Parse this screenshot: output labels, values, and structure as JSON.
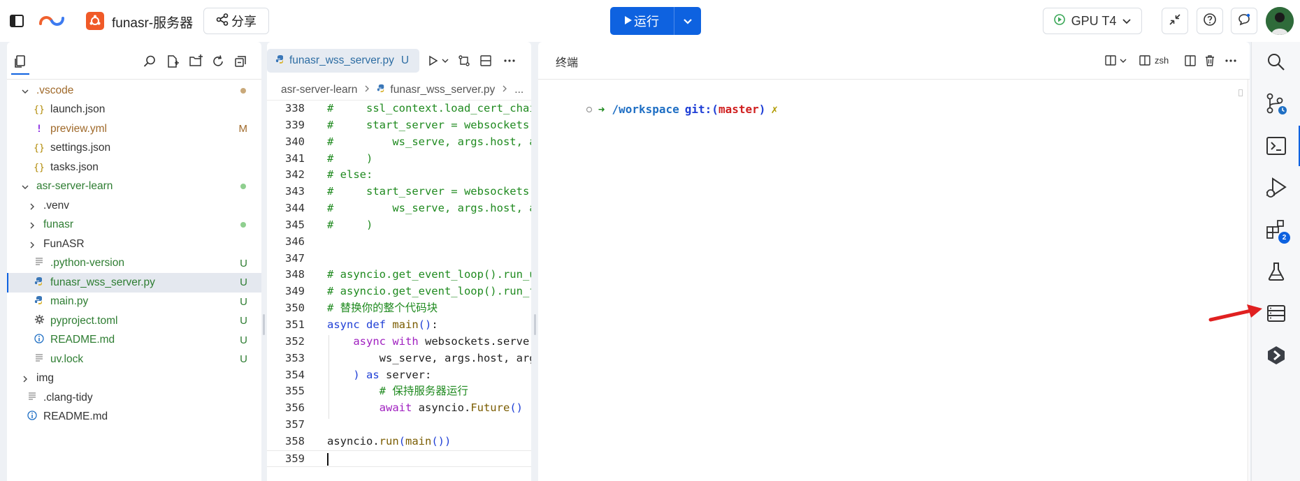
{
  "topbar": {
    "project_name": "funasr-服务器",
    "share_label": "分享",
    "run_label": "运行",
    "gpu_label": "GPU T4"
  },
  "explorer": {
    "tree": [
      {
        "name": ".vscode",
        "type": "folder",
        "open": true,
        "depth": 0,
        "status": "dot",
        "color": "mod"
      },
      {
        "name": "launch.json",
        "type": "json",
        "depth": 1,
        "color": "plain"
      },
      {
        "name": "preview.yml",
        "type": "yml",
        "depth": 1,
        "status": "M",
        "color": "mod"
      },
      {
        "name": "settings.json",
        "type": "json",
        "depth": 1,
        "color": "plain"
      },
      {
        "name": "tasks.json",
        "type": "json",
        "depth": 1,
        "color": "plain"
      },
      {
        "name": "asr-server-learn",
        "type": "folder",
        "open": true,
        "depth": 0,
        "status": "dot",
        "color": "untracked"
      },
      {
        "name": ".venv",
        "type": "folder",
        "open": false,
        "depth": 1,
        "color": "plain"
      },
      {
        "name": "funasr",
        "type": "folder",
        "open": false,
        "depth": 1,
        "status": "dot",
        "color": "untracked"
      },
      {
        "name": "FunASR",
        "type": "folder",
        "open": false,
        "depth": 1,
        "color": "plain"
      },
      {
        "name": ".python-version",
        "type": "text",
        "depth": 1,
        "status": "U",
        "color": "untracked"
      },
      {
        "name": "funasr_wss_server.py",
        "type": "python",
        "depth": 1,
        "status": "U",
        "color": "untracked",
        "selected": true
      },
      {
        "name": "main.py",
        "type": "python",
        "depth": 1,
        "status": "U",
        "color": "untracked"
      },
      {
        "name": "pyproject.toml",
        "type": "toml",
        "depth": 1,
        "status": "U",
        "color": "untracked"
      },
      {
        "name": "README.md",
        "type": "info",
        "depth": 1,
        "status": "U",
        "color": "untracked"
      },
      {
        "name": "uv.lock",
        "type": "text",
        "depth": 1,
        "status": "U",
        "color": "untracked"
      },
      {
        "name": "img",
        "type": "folder",
        "open": false,
        "depth": 0,
        "color": "plain"
      },
      {
        "name": ".clang-tidy",
        "type": "text",
        "depth": 0,
        "color": "plain"
      },
      {
        "name": "README.md",
        "type": "info",
        "depth": 0,
        "color": "plain"
      }
    ]
  },
  "editor": {
    "tab": {
      "name": "funasr_wss_server.py",
      "status": "U"
    },
    "breadcrumb": [
      "asr-server-learn",
      "funasr_wss_server.py",
      "..."
    ],
    "lines": [
      {
        "n": "338",
        "code": [
          [
            "cm",
            "#     ssl_context.load_cert_chain("
          ]
        ]
      },
      {
        "n": "339",
        "code": [
          [
            "cm",
            "#     start_server = websockets.serve("
          ]
        ]
      },
      {
        "n": "340",
        "code": [
          [
            "cm",
            "#         ws_serve, args.host, args.port"
          ]
        ]
      },
      {
        "n": "341",
        "code": [
          [
            "cm",
            "#     )"
          ]
        ]
      },
      {
        "n": "342",
        "code": [
          [
            "cm",
            "# else:"
          ]
        ]
      },
      {
        "n": "343",
        "code": [
          [
            "cm",
            "#     start_server = websockets.serve("
          ]
        ]
      },
      {
        "n": "344",
        "code": [
          [
            "cm",
            "#         ws_serve, args.host, args.port"
          ]
        ]
      },
      {
        "n": "345",
        "code": [
          [
            "cm",
            "#     )"
          ]
        ]
      },
      {
        "n": "346",
        "code": []
      },
      {
        "n": "347",
        "code": []
      },
      {
        "n": "348",
        "code": [
          [
            "cm",
            "# asyncio.get_event_loop().run_until_complete("
          ]
        ]
      },
      {
        "n": "349",
        "code": [
          [
            "cm",
            "# asyncio.get_event_loop().run_forever()"
          ]
        ]
      },
      {
        "n": "350",
        "code": [
          [
            "cm",
            "# 替换你的整个代码块"
          ]
        ]
      },
      {
        "n": "351",
        "code": [
          [
            "kb",
            "async "
          ],
          [
            "kb",
            "def "
          ],
          [
            "fn",
            "main"
          ],
          [
            "pn",
            "()"
          ],
          [
            "tx",
            ":"
          ]
        ]
      },
      {
        "n": "352",
        "code": [
          [
            "tx",
            "    "
          ],
          [
            "kw",
            "async "
          ],
          [
            "kw",
            "with "
          ],
          [
            "tx",
            "websockets.serve("
          ]
        ]
      },
      {
        "n": "353",
        "code": [
          [
            "tx",
            "        ws_serve, args.host, args.port"
          ]
        ]
      },
      {
        "n": "354",
        "code": [
          [
            "tx",
            "    "
          ],
          [
            "pn",
            ") "
          ],
          [
            "kb",
            "as "
          ],
          [
            "tx",
            "server:"
          ]
        ]
      },
      {
        "n": "355",
        "code": [
          [
            "tx",
            "        "
          ],
          [
            "cm",
            "# 保持服务器运行"
          ]
        ]
      },
      {
        "n": "356",
        "code": [
          [
            "tx",
            "        "
          ],
          [
            "kw",
            "await "
          ],
          [
            "tx",
            "asyncio."
          ],
          [
            "fn",
            "Future"
          ],
          [
            "pn",
            "()"
          ]
        ]
      },
      {
        "n": "357",
        "code": []
      },
      {
        "n": "358",
        "code": [
          [
            "tx",
            "asyncio."
          ],
          [
            "fn",
            "run"
          ],
          [
            "pn",
            "("
          ],
          [
            "fn",
            "main"
          ],
          [
            "pn",
            "())"
          ]
        ]
      },
      {
        "n": "359",
        "code": []
      }
    ]
  },
  "terminal": {
    "title": "终端",
    "shell": "zsh",
    "prompt_path": "/workspace",
    "prompt_git": "git:(",
    "prompt_branch": "master",
    "prompt_close": ")",
    "prompt_dirty": "✗"
  },
  "activity": {
    "extensions_badge": "2"
  },
  "colors": {
    "run_blue": "#0e62e0",
    "untracked_green": "#2e7d32",
    "modified_amber": "#a06a2b",
    "comment_green": "#1f8a1f",
    "keyword_purple": "#a020c0",
    "keyword_blue": "#1f3fd6",
    "arrow_red": "#e02020"
  }
}
